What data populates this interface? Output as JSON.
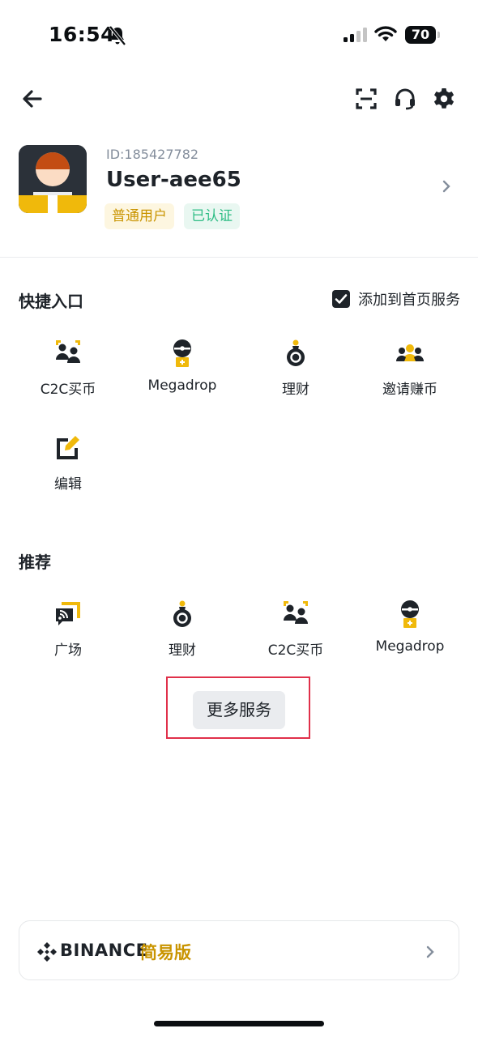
{
  "status_bar": {
    "time": "16:54",
    "battery": "70"
  },
  "profile": {
    "user_id": "ID:185427782",
    "username": "User-aee65",
    "badges": {
      "level": "普通用户",
      "verification": "已认证"
    }
  },
  "quick_access": {
    "title": "快捷入口",
    "add_to_home_label": "添加到首页服务",
    "add_to_home_checked": true,
    "items": [
      {
        "label": "C2C买币",
        "icon": "c2c-icon"
      },
      {
        "label": "Megadrop",
        "icon": "megadrop-icon"
      },
      {
        "label": "理财",
        "icon": "earn-icon"
      },
      {
        "label": "邀请赚币",
        "icon": "referral-icon"
      },
      {
        "label": "编辑",
        "icon": "edit-icon"
      }
    ]
  },
  "recommended": {
    "title": "推荐",
    "items": [
      {
        "label": "广场",
        "icon": "square-icon"
      },
      {
        "label": "理财",
        "icon": "earn-icon"
      },
      {
        "label": "C2C买币",
        "icon": "c2c-icon"
      },
      {
        "label": "Megadrop",
        "icon": "megadrop-icon"
      }
    ]
  },
  "more_services_label": "更多服务",
  "lite_banner": {
    "brand": "BINANCE",
    "mode_label": "简易版"
  },
  "colors": {
    "accent_yellow": "#f0b90b",
    "dark": "#1e2329",
    "highlight_red": "#e0304a"
  }
}
